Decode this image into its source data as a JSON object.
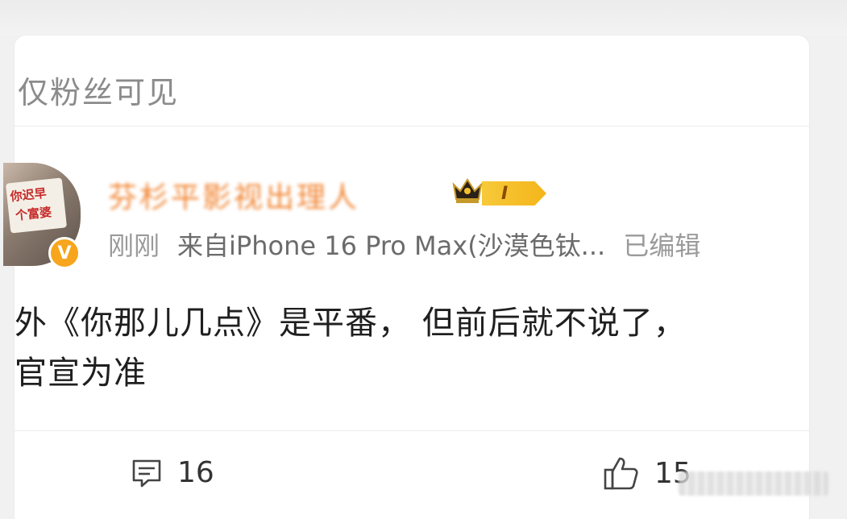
{
  "post": {
    "visibility_label": "仅粉丝可见",
    "author": {
      "name": "芬杉平影视出理人",
      "level_label": "I",
      "verified_mark": "V",
      "avatar_sign_line1": "你迟早",
      "avatar_sign_line2": "个富婆"
    },
    "time": "刚刚",
    "source": "来自iPhone 16 Pro Max(沙漠色钛...",
    "edited": "已编辑",
    "text_line1": "外《你那儿几点》是平番， 但前后就不说了，",
    "text_line2": "官宣为准",
    "comment_count": "16",
    "like_count": "15"
  },
  "colors": {
    "username": "#f07a20",
    "badge": "#f4b51b",
    "verified": "#f7a51c",
    "meta": "#9a9a9a"
  },
  "icons": {
    "crown": "crown-icon",
    "comment": "comment-icon",
    "like": "thumbs-up-icon"
  }
}
